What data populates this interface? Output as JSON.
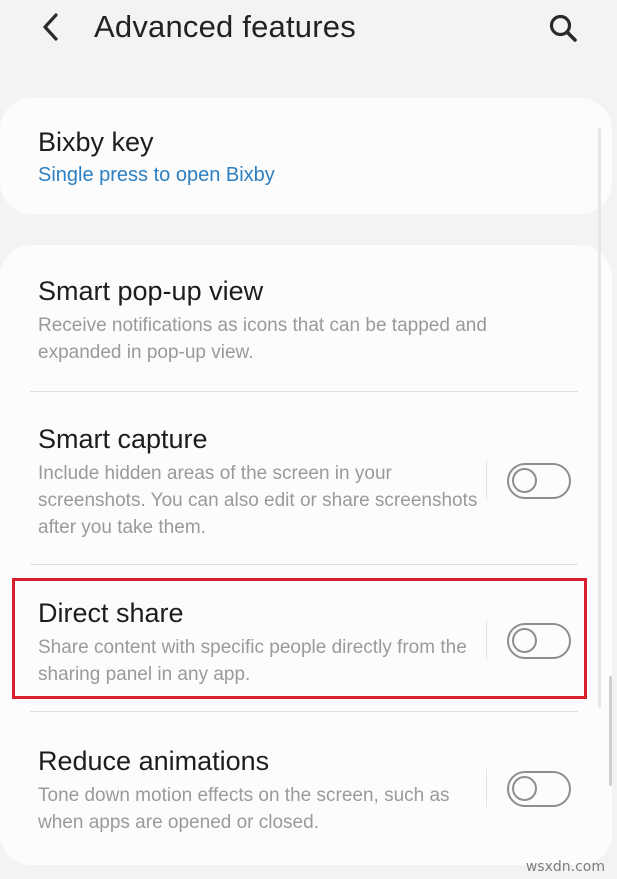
{
  "header": {
    "title": "Advanced features",
    "back_icon": "chevron-left-icon",
    "search_icon": "search-icon"
  },
  "bixby_key": {
    "title": "Bixby key",
    "subtitle": "Single press to open Bixby"
  },
  "settings": [
    {
      "title": "Smart pop-up view",
      "description": "Receive notifications as icons that can be tapped and expanded in pop-up view."
    },
    {
      "title": "Smart capture",
      "description": "Include hidden areas of the screen in your screenshots. You can also edit or share screenshots after you take them.",
      "toggle": "off"
    },
    {
      "title": "Direct share",
      "description": "Share content with specific people directly from the sharing panel in any app.",
      "toggle": "off",
      "highlighted": true
    },
    {
      "title": "Reduce animations",
      "description": "Tone down motion effects on the screen, such as when apps are opened or closed.",
      "toggle": "off"
    }
  ],
  "colors": {
    "accent": "#2c7fc0",
    "highlight": "#d9202c",
    "background": "#f3f3f3",
    "card": "#fcfcfc"
  },
  "watermark": "wsxdn.com"
}
